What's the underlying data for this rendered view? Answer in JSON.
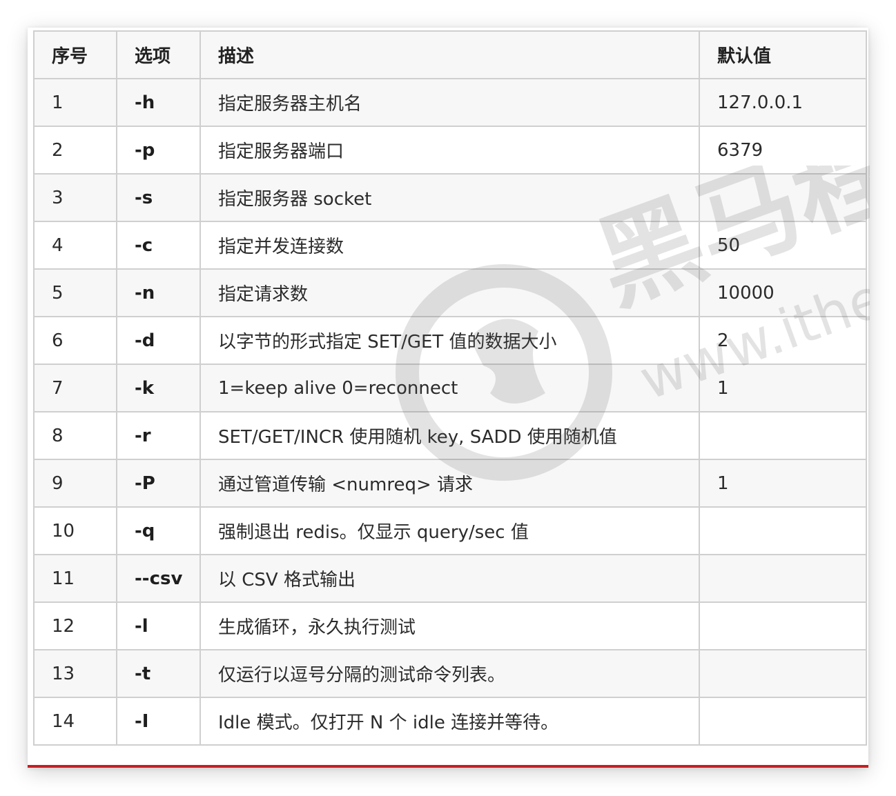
{
  "table": {
    "headers": {
      "index": "序号",
      "option": "选项",
      "description": "描述",
      "default": "默认值"
    },
    "rows": [
      {
        "index": "1",
        "option": "-h",
        "description": "指定服务器主机名",
        "default": "127.0.0.1"
      },
      {
        "index": "2",
        "option": "-p",
        "description": "指定服务器端口",
        "default": "6379"
      },
      {
        "index": "3",
        "option": "-s",
        "description": "指定服务器 socket",
        "default": ""
      },
      {
        "index": "4",
        "option": "-c",
        "description": "指定并发连接数",
        "default": "50"
      },
      {
        "index": "5",
        "option": "-n",
        "description": "指定请求数",
        "default": "10000"
      },
      {
        "index": "6",
        "option": "-d",
        "description": "以字节的形式指定 SET/GET 值的数据大小",
        "default": "2"
      },
      {
        "index": "7",
        "option": "-k",
        "description": "1=keep alive 0=reconnect",
        "default": "1"
      },
      {
        "index": "8",
        "option": "-r",
        "description": "SET/GET/INCR 使用随机 key, SADD 使用随机值",
        "default": ""
      },
      {
        "index": "9",
        "option": "-P",
        "description": "通过管道传输 <numreq> 请求",
        "default": "1"
      },
      {
        "index": "10",
        "option": "-q",
        "description": "强制退出 redis。仅显示 query/sec 值",
        "default": ""
      },
      {
        "index": "11",
        "option": "--csv",
        "description": "以 CSV 格式输出",
        "default": ""
      },
      {
        "index": "12",
        "option": "-l",
        "description": "生成循环，永久执行测试",
        "default": ""
      },
      {
        "index": "13",
        "option": "-t",
        "description": "仅运行以逗号分隔的测试命令列表。",
        "default": ""
      },
      {
        "index": "14",
        "option": "-I",
        "description": "Idle 模式。仅打开 N 个 idle 连接并等待。",
        "default": ""
      }
    ]
  },
  "watermark": {
    "brand_text": "黑马程",
    "url_text": "www.ithe"
  },
  "colors": {
    "border": "#cfcfcf",
    "shaded_row": "#f7f7f7",
    "bottom_accent": "#c41f24"
  }
}
